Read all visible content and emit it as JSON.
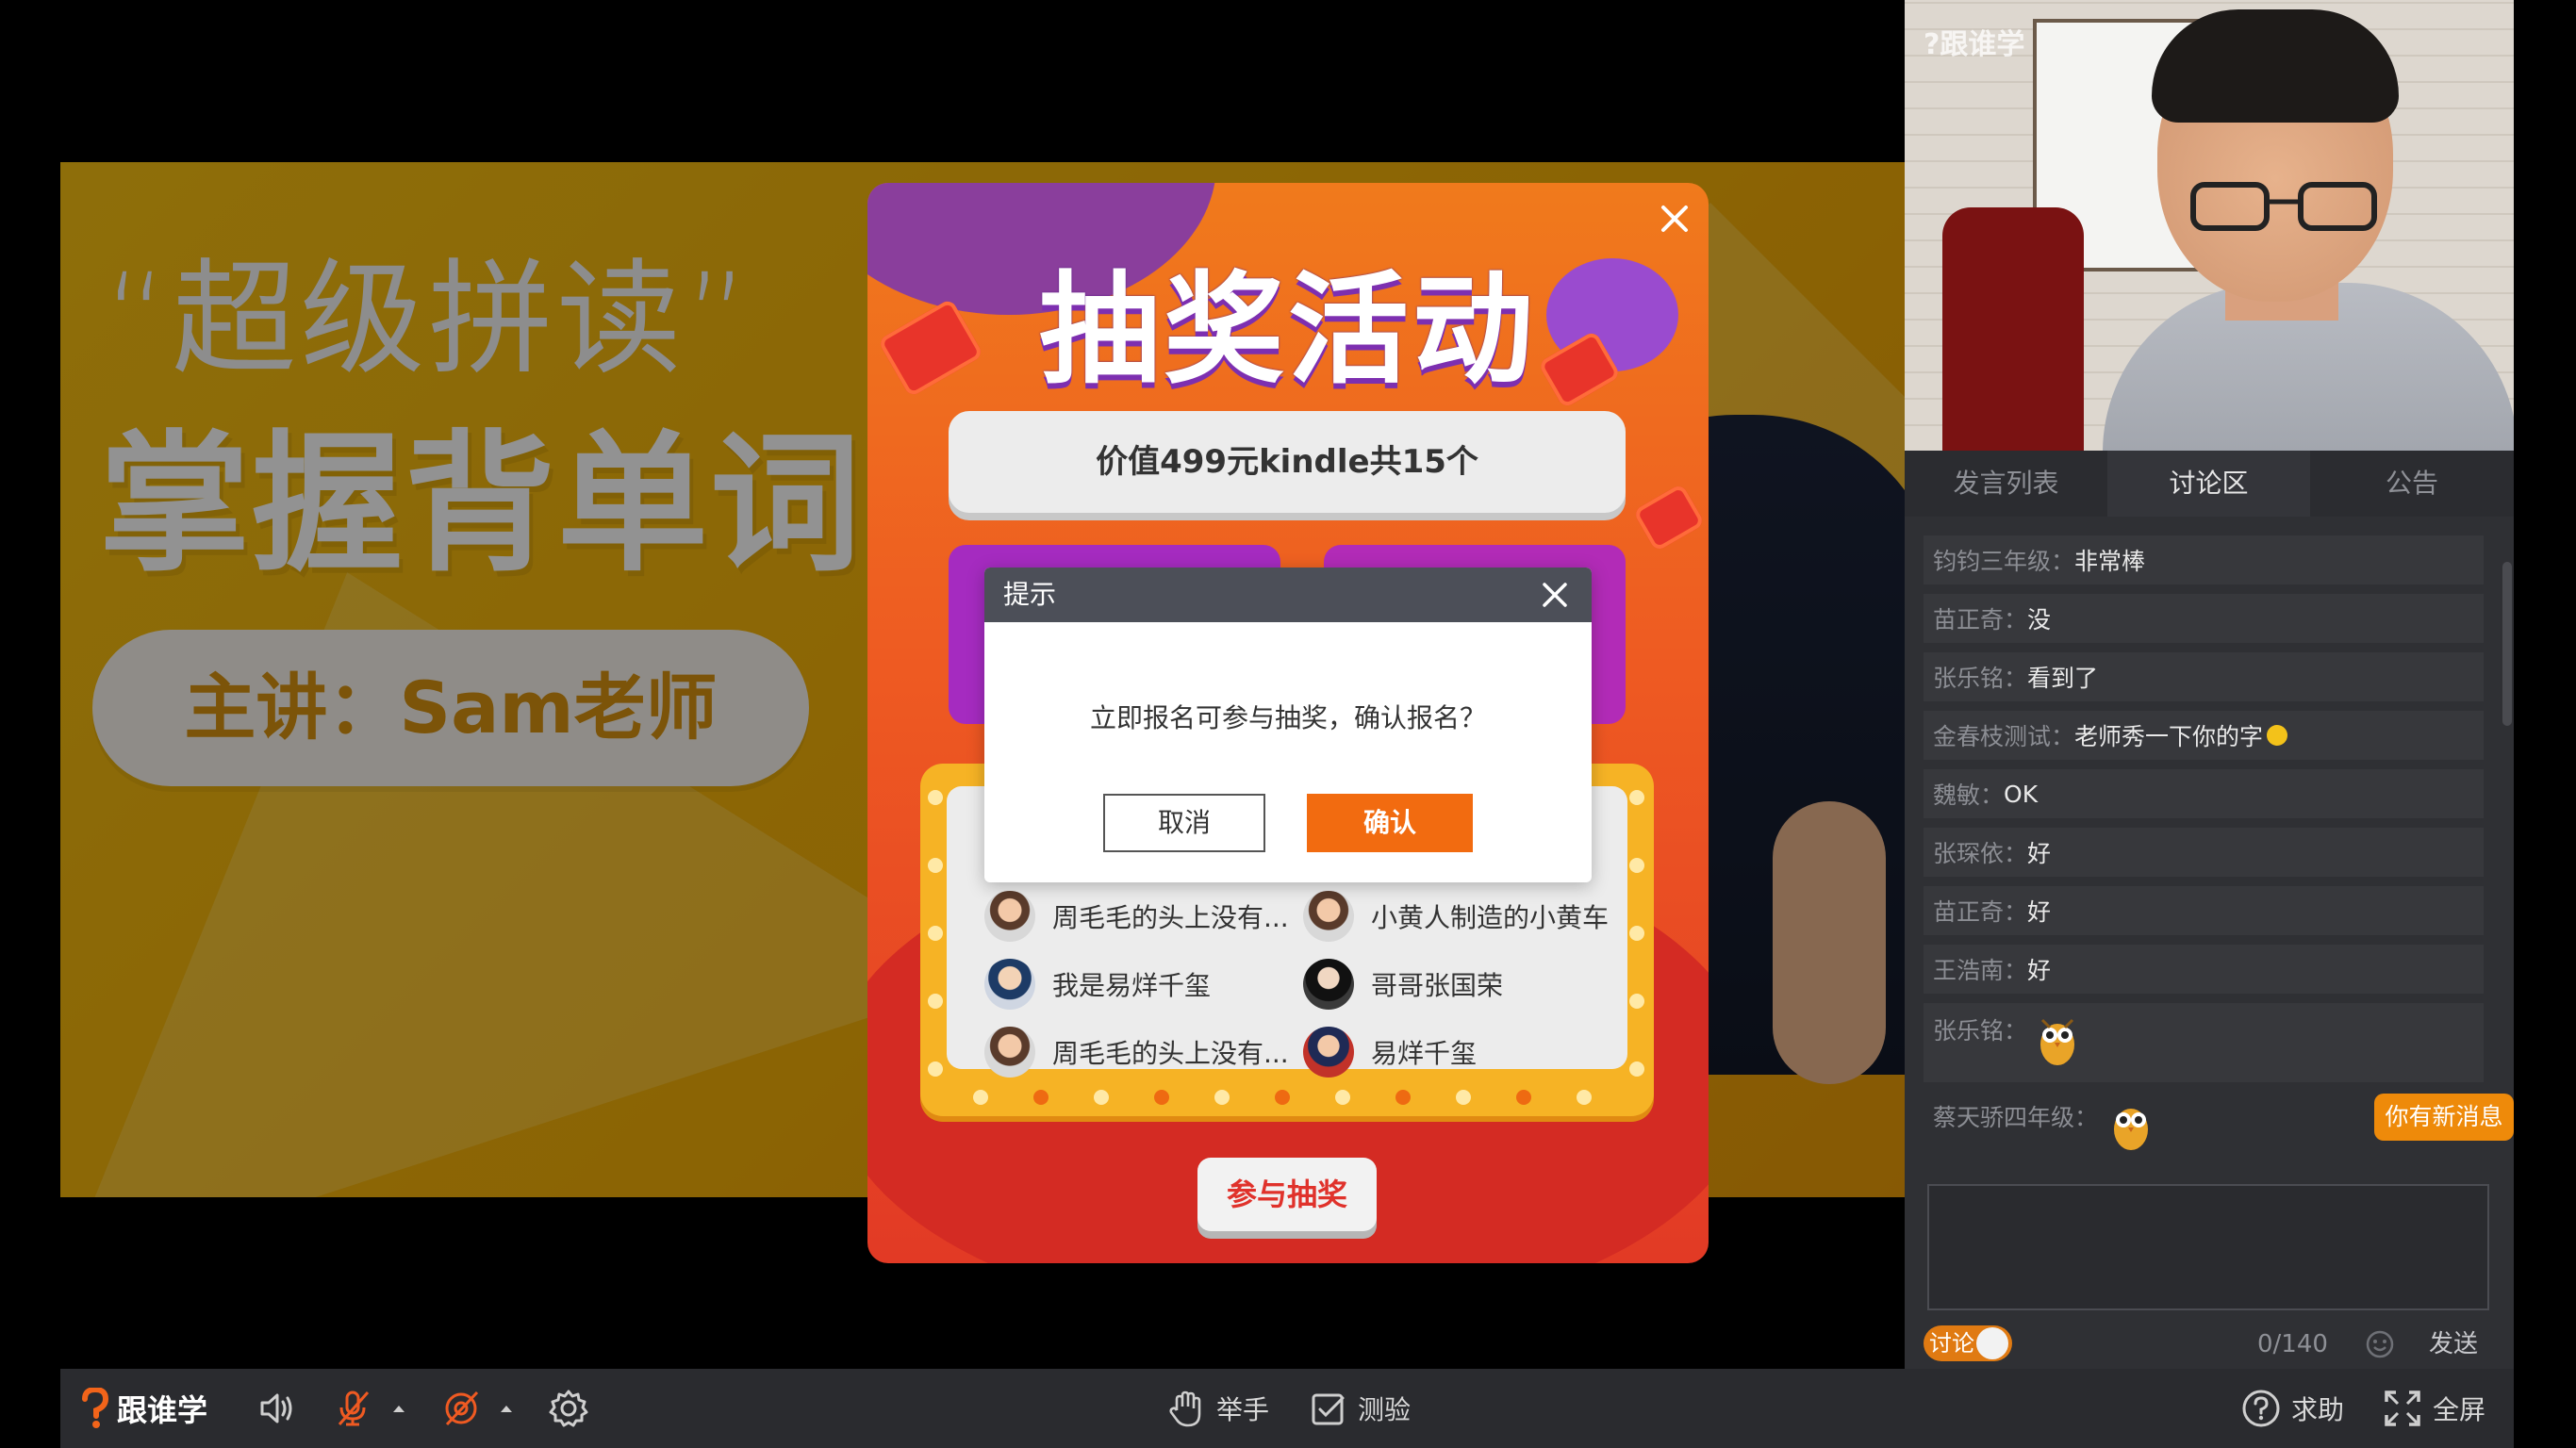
{
  "slide": {
    "line1": "“超级拼读”",
    "line2": "掌握背单词",
    "presenter": "主讲：Sam老师"
  },
  "lottery": {
    "title": "抽奖活动",
    "prize": "价值499元kindle共15个",
    "winners": [
      {
        "name": "周毛毛的头上没有..."
      },
      {
        "name": "小黄人制造的小黄车"
      },
      {
        "name": "我是易烊千玺"
      },
      {
        "name": "哥哥张国荣"
      },
      {
        "name": "周毛毛的头上没有..."
      },
      {
        "name": "易烊千玺"
      }
    ],
    "join_label": "参与抽奖"
  },
  "dialog": {
    "title": "提示",
    "message": "立即报名可参与抽奖，确认报名？",
    "cancel_label": "取消",
    "ok_label": "确认"
  },
  "video": {
    "watermark": "?跟谁学"
  },
  "tabs": [
    {
      "label": "发言列表"
    },
    {
      "label": "讨论区"
    },
    {
      "label": "公告"
    }
  ],
  "chat": {
    "messages": [
      {
        "user": "钧钧三年级：",
        "text": "非常棒"
      },
      {
        "user": "苗正奇：",
        "text": "没"
      },
      {
        "user": "张乐铭：",
        "text": "看到了"
      },
      {
        "user": "金春枝测试：",
        "text": "老师秀一下你的字"
      },
      {
        "user": "魏敏：",
        "text": "OK"
      },
      {
        "user": "张琛依：",
        "text": "好"
      },
      {
        "user": "苗正奇：",
        "text": "好"
      },
      {
        "user": "王浩南：",
        "text": "好"
      },
      {
        "user": "张乐铭：",
        "text": ""
      },
      {
        "user": "蔡天骄四年级：",
        "text": ""
      }
    ],
    "new_message_label": "你有新消息",
    "discuss_label": "讨论",
    "counter": "0/140",
    "send_label": "发送"
  },
  "toolbar": {
    "brand": "跟谁学",
    "raise_hand": "举手",
    "quiz": "测验",
    "help": "求助",
    "fullscreen": "全屏"
  },
  "colors": {
    "accent_orange": "#f26b10",
    "slide_yellow": "#f0ad08",
    "panel_dark": "#2f3034"
  }
}
